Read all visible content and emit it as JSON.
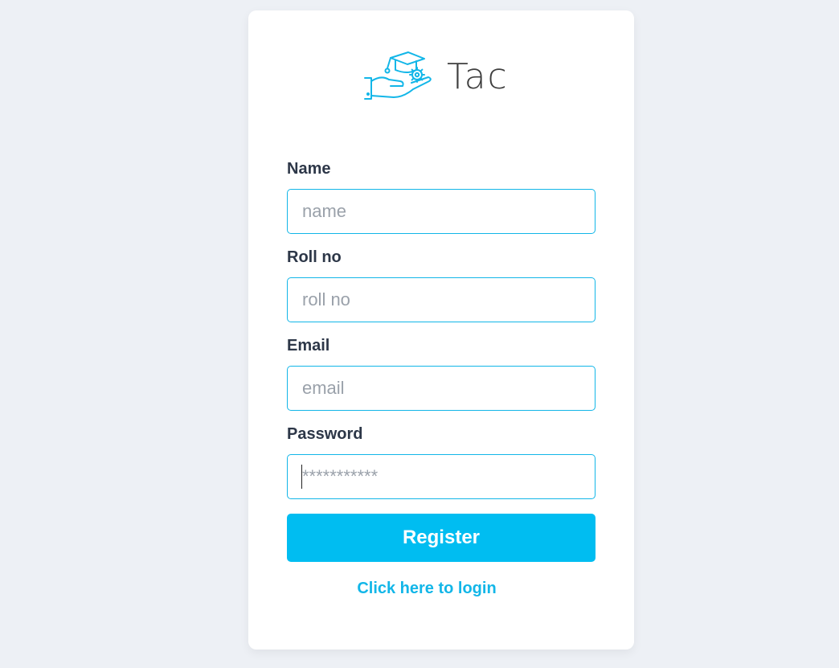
{
  "brand": {
    "name": "Tac",
    "logo_icon": "hand-graduation-cap-gear-icon",
    "accent_color": "#12b6e8"
  },
  "form": {
    "fields": [
      {
        "label": "Name",
        "placeholder": "name",
        "type": "text"
      },
      {
        "label": "Roll no",
        "placeholder": "roll no",
        "type": "text"
      },
      {
        "label": "Email",
        "placeholder": "email",
        "type": "email"
      },
      {
        "label": "Password",
        "placeholder": "***********",
        "type": "password"
      }
    ],
    "submit_label": "Register",
    "submit_color": "#00bdf1",
    "login_link_label": "Click here to login"
  }
}
